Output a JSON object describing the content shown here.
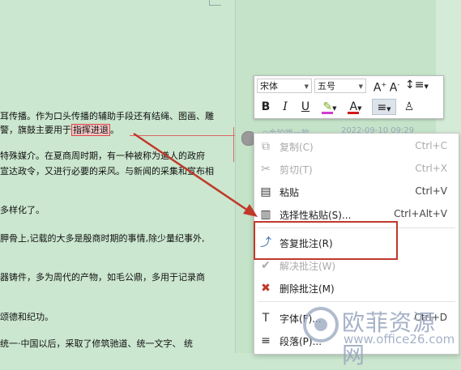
{
  "document": {
    "lines": [
      "耳传播。作为口头传播的辅助手段还有结绳、图画、雕",
      "警，旗鼓主要用于",
      "指挥进退",
      "。",
      "特殊媒介。在夏商周时期，有一种被称为遒人的政府",
      "宣达政令，又进行必要的采风。与新闻的采集和宣布相",
      "多样化了。",
      "胛骨上,记载的大多是殷商时期的事情,除少量纪事外,",
      "器铸件，多为周代的产物，如毛公鼎，多用于记录商",
      "颂德和纪功。",
      "统一·中国以后，采取了修筑驰道、统一文字、 统"
    ]
  },
  "mini_toolbar": {
    "font_name": "宋体",
    "font_size": "五号",
    "grow_font": "A⁺",
    "shrink_font": "A⁻",
    "line_spacing": "≡",
    "bold": "B",
    "italic": "I",
    "underline": "U",
    "highlight": "✎",
    "font_color": "A",
    "align": "≡",
    "format_painter": "♙",
    "colors": {
      "highlight": "#d13bd1",
      "font_color": "#d11a1a"
    }
  },
  "comment": {
    "author": "○金铂跳一款",
    "time": "2022-09-10 09:29"
  },
  "context_menu": {
    "items": [
      {
        "icon": "copy-icon",
        "glyph": "⧉",
        "label": "复制(C)",
        "shortcut": "Ctrl+C",
        "disabled": true
      },
      {
        "icon": "scissors-icon",
        "glyph": "✂",
        "label": "剪切(T)",
        "shortcut": "Ctrl+X",
        "disabled": true
      },
      {
        "icon": "paste-icon",
        "glyph": "📋",
        "label": "粘贴",
        "shortcut": "Ctrl+V",
        "disabled": false
      },
      {
        "icon": "paste-special-icon",
        "glyph": "📋",
        "label": "选择性粘贴(S)...",
        "shortcut": "Ctrl+Alt+V",
        "disabled": false
      },
      {
        "icon": "reply-comment-icon",
        "glyph": "↩",
        "label": "答复批注(R)",
        "shortcut": "",
        "disabled": false
      },
      {
        "icon": "resolve-comment-icon",
        "glyph": "✔",
        "label": "解决批注(W)",
        "shortcut": "",
        "disabled": true
      },
      {
        "icon": "delete-comment-icon",
        "glyph": "✖",
        "label": "删除批注(M)",
        "shortcut": "",
        "disabled": false
      },
      {
        "icon": "font-icon",
        "glyph": "T",
        "label": "字体(F)...",
        "shortcut": "Ctrl+D",
        "disabled": false
      },
      {
        "icon": "paragraph-icon",
        "glyph": "≡",
        "label": "段落(P)...",
        "shortcut": "",
        "disabled": false
      }
    ]
  },
  "watermark": {
    "title": "欧菲资源网",
    "url": "www.office26.com"
  }
}
